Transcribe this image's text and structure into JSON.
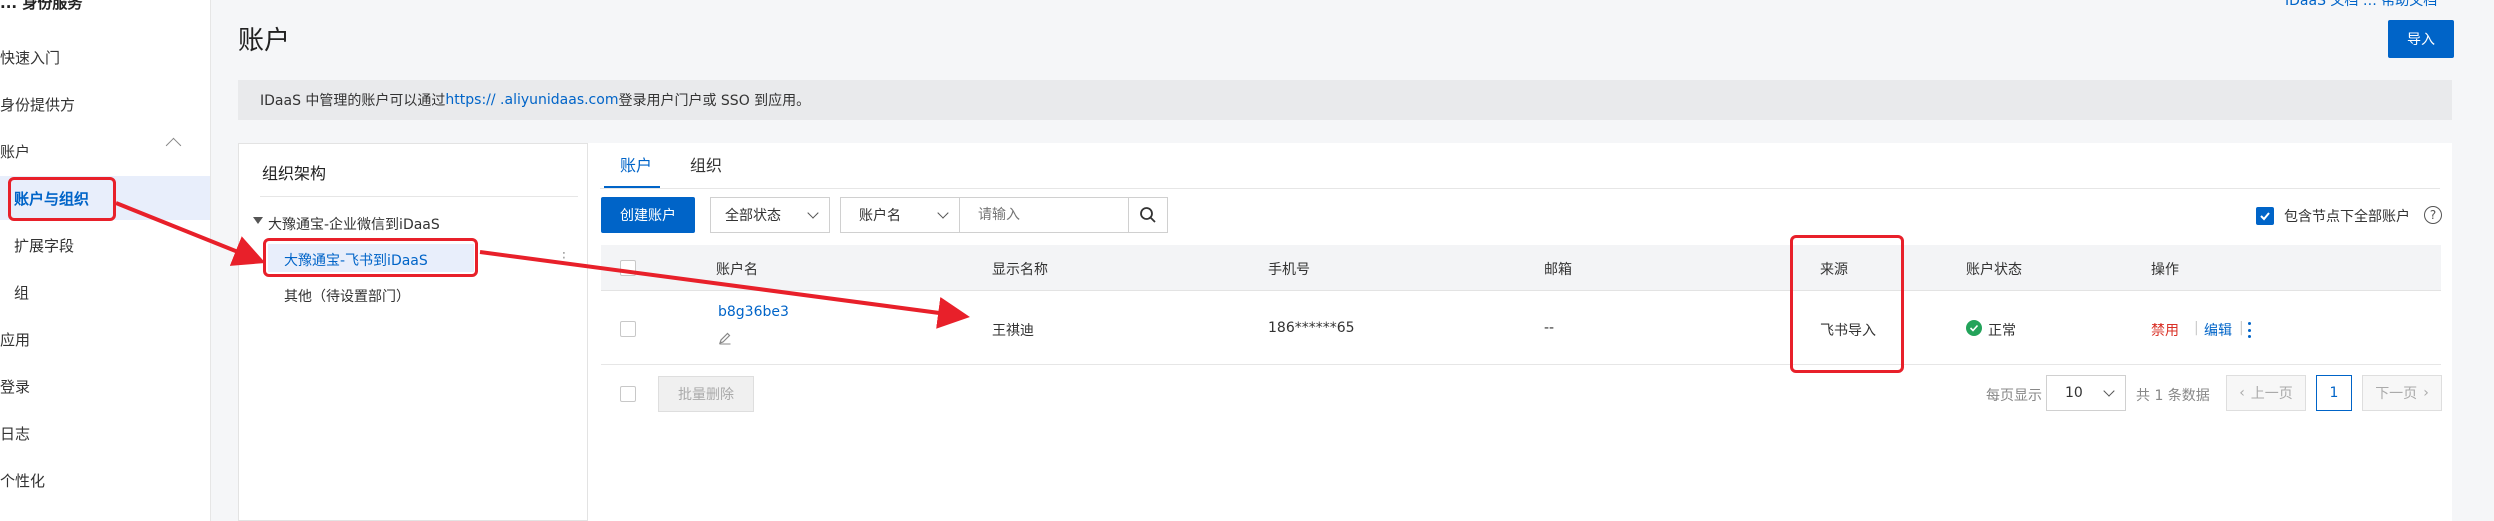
{
  "sidebar": {
    "top_label": "... 身份服务",
    "items": [
      {
        "label": "快速入门"
      },
      {
        "label": "身份提供方"
      },
      {
        "label": "账户"
      },
      {
        "label": "账户与组织"
      },
      {
        "label": "扩展字段"
      },
      {
        "label": "组"
      },
      {
        "label": "应用"
      },
      {
        "label": "登录"
      },
      {
        "label": "日志"
      },
      {
        "label": "个性化"
      }
    ]
  },
  "header": {
    "title": "账户",
    "top_right": "IDaaS 文档 … 帮助文档",
    "import_label": "导入"
  },
  "notice": {
    "before": "IDaaS 中管理的账户可以通过 ",
    "link": "https://          .aliyunidaas.com",
    "after": " 登录用户门户或 SSO 到应用。"
  },
  "org": {
    "title": "组织架构",
    "root": "大豫通宝-企业微信到iDaaS",
    "child1": "大豫通宝-飞书到iDaaS",
    "child2": "其他（待设置部门）",
    "more": "⋮"
  },
  "tabs": [
    {
      "label": "账户"
    },
    {
      "label": "组织"
    }
  ],
  "toolbar": {
    "create_label": "创建账户",
    "status_select": "全部状态",
    "field_select": "账户名",
    "search_placeholder": "请输入",
    "include_label": "包含节点下全部账户",
    "help": "?"
  },
  "table": {
    "headers": [
      "账户名",
      "显示名称",
      "手机号",
      "邮箱",
      "来源",
      "账户状态",
      "操作"
    ],
    "rows": [
      {
        "account": "b8g36be3",
        "display_name": "王祺迪",
        "phone": "186******65",
        "email": "--",
        "source": "飞书导入",
        "status": "正常",
        "action_disable": "禁用",
        "action_edit": "编辑"
      }
    ]
  },
  "footer": {
    "batch_delete": "批量删除",
    "page_size_label": "每页显示",
    "page_size": "10",
    "total": "共 1 条数据",
    "prev": "上一页",
    "current": "1",
    "next": "下一页"
  },
  "colors": {
    "accent": "#0064c8",
    "annotation_red": "#e8202a",
    "status_green": "#23a35a",
    "danger": "#d93026"
  }
}
